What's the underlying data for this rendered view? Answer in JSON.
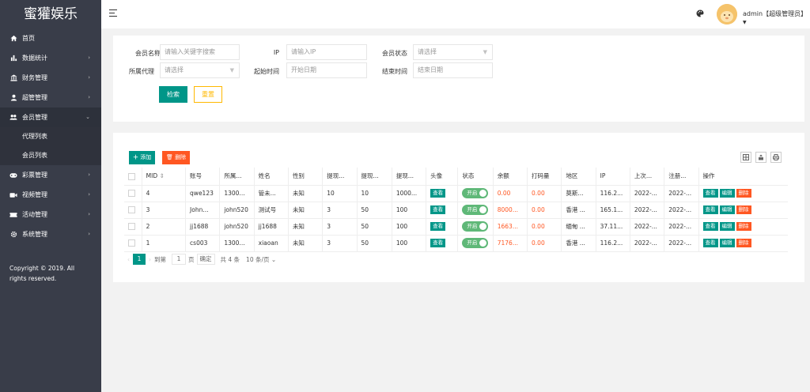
{
  "app": {
    "title": "蜜獾娱乐"
  },
  "sidebar": {
    "items": [
      {
        "label": "首页",
        "icon": "home-icon"
      },
      {
        "label": "数据统计",
        "icon": "bar-chart-icon"
      },
      {
        "label": "财务管理",
        "icon": "bank-icon"
      },
      {
        "label": "超管管理",
        "icon": "user-icon"
      },
      {
        "label": "会员管理",
        "icon": "users-icon"
      },
      {
        "label": "彩票管理",
        "icon": "gamepad-icon"
      },
      {
        "label": "视频管理",
        "icon": "video-icon"
      },
      {
        "label": "活动管理",
        "icon": "ticket-icon"
      },
      {
        "label": "系统管理",
        "icon": "gear-icon"
      }
    ],
    "submenu": [
      {
        "label": "代理列表"
      },
      {
        "label": "会员列表"
      }
    ],
    "copyright": "Copyright © 2019. All rights reserved."
  },
  "header": {
    "user": "admin【超级管理员】"
  },
  "search": {
    "member_name_label": "会员名称",
    "member_name_placeholder": "请输入关键字搜索",
    "ip_label": "IP",
    "ip_placeholder": "请输入IP",
    "status_label": "会员状态",
    "status_placeholder": "请选择",
    "agent_label": "所属代理",
    "agent_placeholder": "请选择",
    "start_label": "起始时间",
    "start_placeholder": "开始日期",
    "end_label": "结束时间",
    "end_placeholder": "结束日期",
    "search_btn": "检索",
    "reset_btn": "重置"
  },
  "toolbar": {
    "add": "添加",
    "delete": "删除"
  },
  "table": {
    "headers": [
      "MID",
      "账号",
      "所属...",
      "姓名",
      "性别",
      "提现...",
      "提现...",
      "提现...",
      "头像",
      "状态",
      "余额",
      "打码量",
      "地区",
      "IP",
      "上次...",
      "注册...",
      "操作"
    ],
    "view_tag": "查看",
    "switch_on": "开启",
    "ops": {
      "view": "查看",
      "edit": "编辑",
      "del": "删除"
    },
    "rows": [
      {
        "mid": "4",
        "account": "qwe123",
        "agent": "1300...",
        "name": "管未...",
        "gender": "未知",
        "w1": "10",
        "w2": "10",
        "w3": "1000...",
        "balance": "0.00",
        "code": "0.00",
        "region": "莫斯...",
        "ip": "116.2...",
        "last": "2022-...",
        "reg": "2022-..."
      },
      {
        "mid": "3",
        "account": "John...",
        "agent": "john520",
        "name": "测试号",
        "gender": "未知",
        "w1": "3",
        "w2": "50",
        "w3": "100",
        "balance": "8000...",
        "code": "0.00",
        "region": "香港 ...",
        "ip": "165.1...",
        "last": "2022-...",
        "reg": "2022-..."
      },
      {
        "mid": "2",
        "account": "jj1688",
        "agent": "john520",
        "name": "jj1688",
        "gender": "未知",
        "w1": "3",
        "w2": "50",
        "w3": "100",
        "balance": "1663...",
        "code": "0.00",
        "region": "缅甸 ...",
        "ip": "37.11...",
        "last": "2022-...",
        "reg": "2022-..."
      },
      {
        "mid": "1",
        "account": "cs003",
        "agent": "1300...",
        "name": "xiaoan",
        "gender": "未知",
        "w1": "3",
        "w2": "50",
        "w3": "100",
        "balance": "7176...",
        "code": "0.00",
        "region": "香港 ...",
        "ip": "116.2...",
        "last": "2022-...",
        "reg": "2022-..."
      }
    ]
  },
  "pager": {
    "current": "1",
    "goto_label": "到第",
    "goto_value": "1",
    "page_unit": "页",
    "confirm": "确定",
    "total": "共 4 条",
    "per_page": "10 条/页"
  }
}
